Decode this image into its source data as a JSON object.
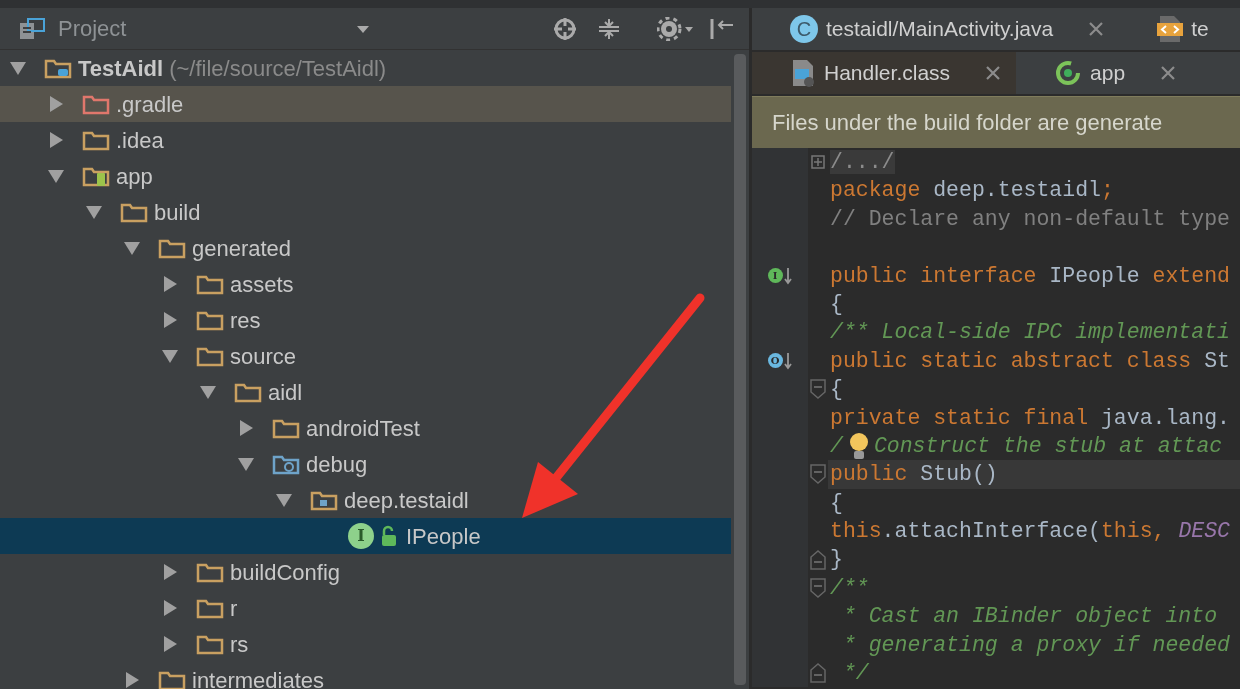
{
  "project_panel": {
    "title": "Project"
  },
  "tree": [
    {
      "label": "TestAidl",
      "path": "(~/file/source/TestAidl)",
      "kind": "project",
      "expanded": true,
      "selected": false,
      "highlighted": false,
      "children": [
        {
          "label": ".gradle",
          "kind": "excluded",
          "expanded": false,
          "selected": false,
          "highlighted": true
        },
        {
          "label": ".idea",
          "kind": "folder",
          "expanded": false,
          "selected": false,
          "highlighted": false
        },
        {
          "label": "app",
          "kind": "module",
          "expanded": true,
          "selected": false,
          "highlighted": false,
          "children": [
            {
              "label": "build",
              "kind": "folder",
              "expanded": true,
              "selected": false,
              "highlighted": false,
              "children": [
                {
                  "label": "generated",
                  "kind": "folder",
                  "expanded": true,
                  "selected": false,
                  "highlighted": false,
                  "children": [
                    {
                      "label": "assets",
                      "kind": "folder",
                      "expanded": false,
                      "selected": false,
                      "highlighted": false
                    },
                    {
                      "label": "res",
                      "kind": "folder",
                      "expanded": false,
                      "selected": false,
                      "highlighted": false
                    },
                    {
                      "label": "source",
                      "kind": "folder",
                      "expanded": true,
                      "selected": false,
                      "highlighted": false,
                      "children": [
                        {
                          "label": "aidl",
                          "kind": "folder",
                          "expanded": true,
                          "selected": false,
                          "highlighted": false,
                          "children": [
                            {
                              "label": "androidTest",
                              "kind": "folder",
                              "expanded": false,
                              "selected": false,
                              "highlighted": false
                            },
                            {
                              "label": "debug",
                              "kind": "source",
                              "expanded": true,
                              "selected": false,
                              "highlighted": false,
                              "children": [
                                {
                                  "label": "deep.testaidl",
                                  "kind": "package",
                                  "expanded": true,
                                  "selected": false,
                                  "highlighted": false,
                                  "children": [
                                    {
                                      "label": "IPeople",
                                      "kind": "interface",
                                      "icon_text": "I",
                                      "selected": true,
                                      "highlighted": false
                                    }
                                  ]
                                }
                              ]
                            }
                          ]
                        }
                      ]
                    },
                    {
                      "label": "buildConfig",
                      "kind": "folder",
                      "expanded": false,
                      "selected": false,
                      "highlighted": false
                    },
                    {
                      "label": "r",
                      "kind": "folder",
                      "expanded": false,
                      "selected": false,
                      "highlighted": false
                    },
                    {
                      "label": "rs",
                      "kind": "folder",
                      "expanded": false,
                      "selected": false,
                      "highlighted": false
                    }
                  ]
                },
                {
                  "label": "intermediates",
                  "kind": "folder",
                  "expanded": false,
                  "selected": false,
                  "highlighted": false
                }
              ]
            }
          ]
        }
      ]
    }
  ],
  "tab_rows": [
    {
      "tabs": [
        {
          "label": "testaidl/MainActivity.java",
          "kind": "class",
          "icon_text": "C",
          "closable": true,
          "selected": false
        },
        {
          "label": "te",
          "kind": "xml",
          "closable": false,
          "selected": false
        }
      ]
    },
    {
      "tabs": [
        {
          "label": "Handler.class",
          "kind": "classfile",
          "closable": true,
          "selected": true
        },
        {
          "label": "app",
          "kind": "module",
          "closable": true,
          "selected": false
        }
      ]
    }
  ],
  "notification": "Files under the build folder are generate",
  "code_lines": [
    {
      "fold": {
        "kind": "collapsed"
      },
      "current": false,
      "intention": false,
      "segments": [
        {
          "kind": "folded",
          "text": "/.../"
        }
      ]
    },
    {
      "current": false,
      "intention": false,
      "segments": [
        {
          "kind": "keyword",
          "text": "package "
        },
        {
          "kind": "plain",
          "text": "deep.testaidl"
        },
        {
          "kind": "keyword",
          "text": ";"
        }
      ]
    },
    {
      "current": false,
      "intention": false,
      "segments": [
        {
          "kind": "comment",
          "text": "// Declare any non-default type"
        }
      ]
    },
    {
      "current": false,
      "intention": false
    },
    {
      "gutter": {
        "kind": "implemented",
        "text": "I"
      },
      "current": false,
      "intention": false,
      "segments": [
        {
          "kind": "keyword",
          "text": "public interface "
        },
        {
          "kind": "plain",
          "text": "IPeople "
        },
        {
          "kind": "keyword",
          "text": "extend"
        }
      ]
    },
    {
      "current": false,
      "intention": false,
      "segments": [
        {
          "kind": "plain",
          "text": "{"
        }
      ]
    },
    {
      "current": false,
      "intention": false,
      "segments": [
        {
          "kind": "doc",
          "text": "/** Local-side IPC implementati"
        }
      ]
    },
    {
      "gutter": {
        "kind": "overridden",
        "text": "O"
      },
      "current": false,
      "intention": false,
      "segments": [
        {
          "kind": "keyword",
          "text": "public static abstract class "
        },
        {
          "kind": "plain",
          "text": "St"
        }
      ]
    },
    {
      "fold": {
        "kind": "start"
      },
      "current": false,
      "intention": false,
      "segments": [
        {
          "kind": "plain",
          "text": "{"
        }
      ]
    },
    {
      "current": false,
      "intention": false,
      "segments": [
        {
          "kind": "keyword",
          "text": "private static final "
        },
        {
          "kind": "plain",
          "text": "java.lang."
        }
      ]
    },
    {
      "current": false,
      "intention": true,
      "segments": [
        {
          "kind": "doc",
          "text": "/"
        },
        {
          "kind": "doc",
          "text": "Construct the stub at attac"
        }
      ]
    },
    {
      "fold": {
        "kind": "start"
      },
      "current": true,
      "intention": false,
      "segments": [
        {
          "kind": "keyword",
          "text": "public "
        },
        {
          "kind": "plain",
          "text": "Stub()"
        }
      ]
    },
    {
      "current": false,
      "intention": false,
      "segments": [
        {
          "kind": "plain",
          "text": "{"
        }
      ]
    },
    {
      "current": false,
      "intention": false,
      "segments": [
        {
          "kind": "keyword",
          "text": "this"
        },
        {
          "kind": "plain",
          "text": ".attachInterface("
        },
        {
          "kind": "keyword",
          "text": "this, "
        },
        {
          "kind": "constant",
          "text": "DESC"
        }
      ]
    },
    {
      "fold": {
        "kind": "end"
      },
      "current": false,
      "intention": false,
      "segments": [
        {
          "kind": "plain",
          "text": "}"
        }
      ]
    },
    {
      "fold": {
        "kind": "start"
      },
      "current": false,
      "intention": false,
      "segments": [
        {
          "kind": "doc",
          "text": "/**"
        }
      ]
    },
    {
      "current": false,
      "intention": false,
      "segments": [
        {
          "kind": "doc",
          "text": " * Cast an IBinder object into"
        }
      ]
    },
    {
      "current": false,
      "intention": false,
      "segments": [
        {
          "kind": "doc",
          "text": " * generating a proxy if needed"
        }
      ]
    },
    {
      "fold": {
        "kind": "end"
      },
      "current": false,
      "intention": false,
      "segments": [
        {
          "kind": "doc",
          "text": " */"
        }
      ]
    }
  ]
}
